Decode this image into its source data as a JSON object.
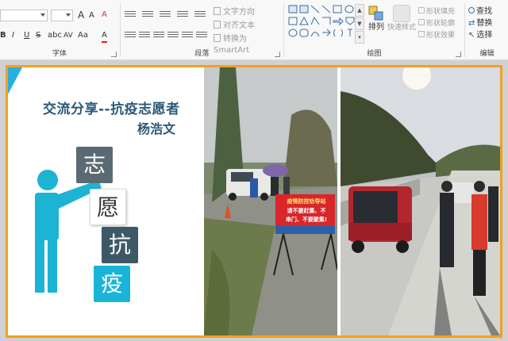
{
  "ribbon": {
    "font_group": {
      "label": "字体",
      "grow_font": "A",
      "shrink_font": "A",
      "clear_format": "A",
      "bold": "B",
      "italic": "I",
      "underline": "U",
      "strike": "S",
      "shadow": "abc",
      "spacing": "AV",
      "case": "Aa",
      "color": "A"
    },
    "paragraph_group": {
      "label": "段落",
      "text_direction": "文字方向",
      "align_text": "对齐文本",
      "smartart": "转换为 SmartArt"
    },
    "drawing_group": {
      "label": "绘图",
      "arrange": "排列",
      "quick_styles": "快速样式",
      "shape_fill": "形状填充",
      "shape_outline": "形状轮廓",
      "shape_effects": "形状效果"
    },
    "editing_group": {
      "label": "编辑",
      "find": "查找",
      "replace": "替换",
      "select": "选择"
    }
  },
  "slide": {
    "title": "交流分享--抗疫志愿者",
    "author": "杨浩文",
    "chars": [
      "志",
      "愿",
      "抗",
      "疫"
    ],
    "banner_line1": "疫情防控劝导站",
    "banner_line2": "请不要赶集、不",
    "banner_line3": "串门、不要聚集!"
  },
  "colors": {
    "accent_orange": "#f2a11f",
    "accent_blue": "#29aee0",
    "title_blue": "#2a5a79",
    "figure_teal": "#1db3d4"
  }
}
